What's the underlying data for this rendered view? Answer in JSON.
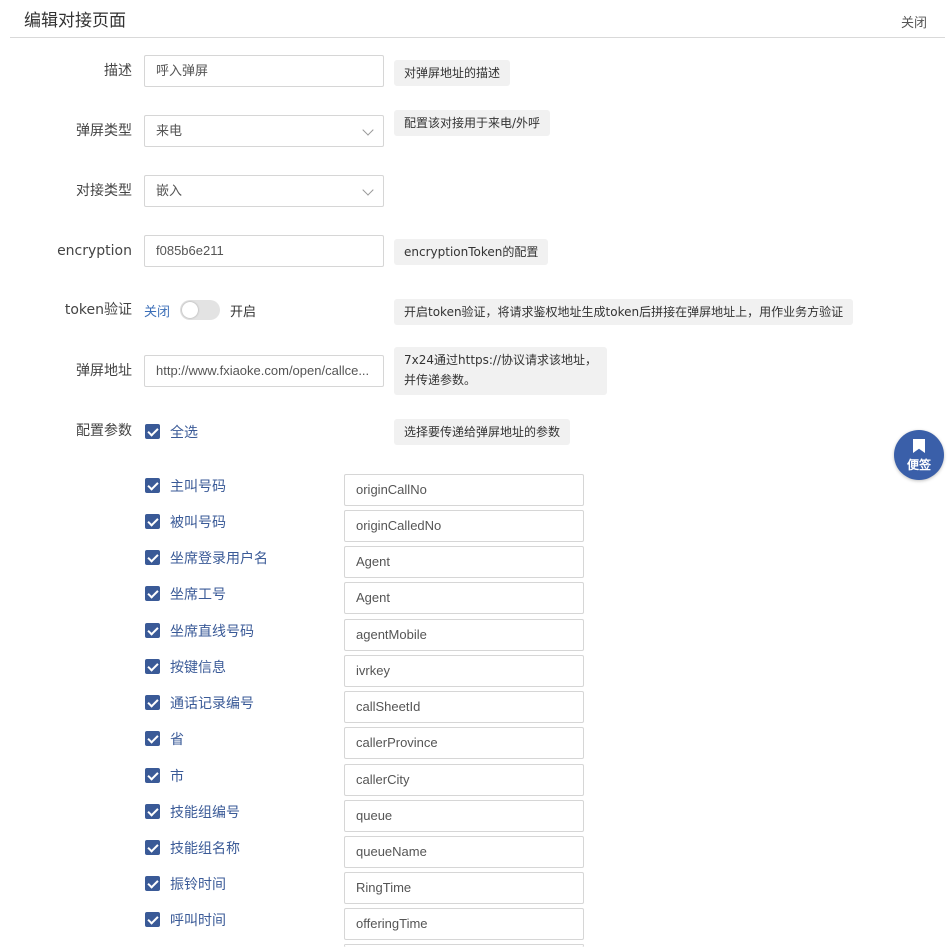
{
  "header": {
    "title": "编辑对接页面",
    "close_label": "关闭"
  },
  "form": {
    "description": {
      "label": "描述",
      "value": "呼入弹屏",
      "tip": "对弹屏地址的描述"
    },
    "popup_type": {
      "label": "弹屏类型",
      "value": "来电",
      "tip": "配置该对接用于来电/外呼"
    },
    "dock_type": {
      "label": "对接类型",
      "value": "嵌入"
    },
    "encryption": {
      "label": "encryption",
      "value": "f085b6e211",
      "tip": "encryptionToken的配置"
    },
    "token": {
      "label": "token验证",
      "off_label": "关闭",
      "on_label": "开启",
      "enabled": false,
      "tip": "开启token验证，将请求鉴权地址生成token后拼接在弹屏地址上，用作业务方验证"
    },
    "url": {
      "label": "弹屏地址",
      "value": "http://www.fxiaoke.com/open/callce...",
      "tip_line1": "7x24通过https://协议请求该地址，",
      "tip_line2": "并传递参数。"
    },
    "params": {
      "label": "配置参数",
      "select_all_label": "全选",
      "select_all_checked": true,
      "tip": "选择要传递给弹屏地址的参数"
    }
  },
  "params": [
    {
      "label": "主叫号码",
      "value": "originCallNo",
      "checked": true
    },
    {
      "label": "被叫号码",
      "value": "originCalledNo",
      "checked": true
    },
    {
      "label": "坐席登录用户名",
      "value": "Agent",
      "checked": true
    },
    {
      "label": "坐席工号",
      "value": "Agent",
      "checked": true
    },
    {
      "label": "坐席直线号码",
      "value": "agentMobile",
      "checked": true
    },
    {
      "label": "按键信息",
      "value": "ivrkey",
      "checked": true
    },
    {
      "label": "通话记录编号",
      "value": "callSheetId",
      "checked": true
    },
    {
      "label": "省",
      "value": "callerProvince",
      "checked": true
    },
    {
      "label": "市",
      "value": "callerCity",
      "checked": true
    },
    {
      "label": "技能组编号",
      "value": "queue",
      "checked": true
    },
    {
      "label": "技能组名称",
      "value": "queueName",
      "checked": true
    },
    {
      "label": "振铃时间",
      "value": "RingTime",
      "checked": true
    },
    {
      "label": "呼叫时间",
      "value": "offeringTime",
      "checked": true
    }
  ],
  "sticky_note": {
    "label": "便签",
    "icon": "bookmark-icon"
  },
  "colors": {
    "accent": "#3a5a97",
    "sticky": "#3a5fa9",
    "tip_bg": "#f1f1f1"
  }
}
